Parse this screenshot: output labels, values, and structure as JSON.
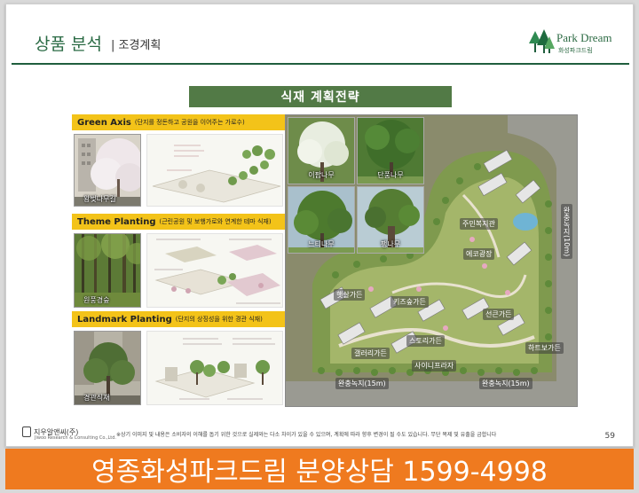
{
  "header": {
    "title": "상품 분석",
    "subtitle": "| 조경계획",
    "logo_text": "Park Dream",
    "logo_sub": "화성파크드림"
  },
  "banner": {
    "label": "식재 계획전략"
  },
  "sections": [
    {
      "title": "Green Axis",
      "note": "(단지를 정돈하고 공원을 이어주는 가로수)",
      "photo_label": "왕벚나무길"
    },
    {
      "title": "Theme Planting",
      "note": "(근린공원 및 보행가로와 연계한 테마 식재)",
      "photo_label": "원풍경숲"
    },
    {
      "title": "Landmark Planting",
      "note": "(단지의 상징성을 위한 경관 식재)",
      "photo_label": "경관식재"
    }
  ],
  "tree_photos": [
    "이팝나무",
    "단풍나무",
    "느티나무",
    "팽나무"
  ],
  "map_labels": {
    "resident_hall": "주민복지관",
    "eco_square": "에코광장",
    "herb_garden": "햇살가든",
    "kids_garden": "키즈숲가든",
    "sun_garden": "선큰가든",
    "gallery_garden": "갤러리가든",
    "story_garden": "스토리가든",
    "heart_garden": "하트보가든",
    "sky_plaza": "사이니프라자",
    "buffer_left": "완충녹지(15m)",
    "buffer_right": "완충녹지(15m)",
    "buffer_vertical": "완충녹지(10m)"
  },
  "footer": {
    "company": "지우알앤씨(주)",
    "company_sub": "Jiwoo Research & Consulting Co.,Ltd.",
    "disclaimer": "※상기 이미지 및 내용은 소비자의 이해를 돕기 위한 것으로 실제와는 다소 차이가 있을 수 있으며, 계획에 따라 향후 변경이 될 수도 있습니다. 무단 복제 및 유출을 금합니다",
    "page_number": "59"
  },
  "ad": {
    "text": "영종화성파크드림 분양상담  1599-4998"
  },
  "colors": {
    "brand_green": "#2b6b45",
    "banner_green": "#527a46",
    "section_yellow": "#f3c319",
    "ad_orange": "#ef7a1f"
  }
}
